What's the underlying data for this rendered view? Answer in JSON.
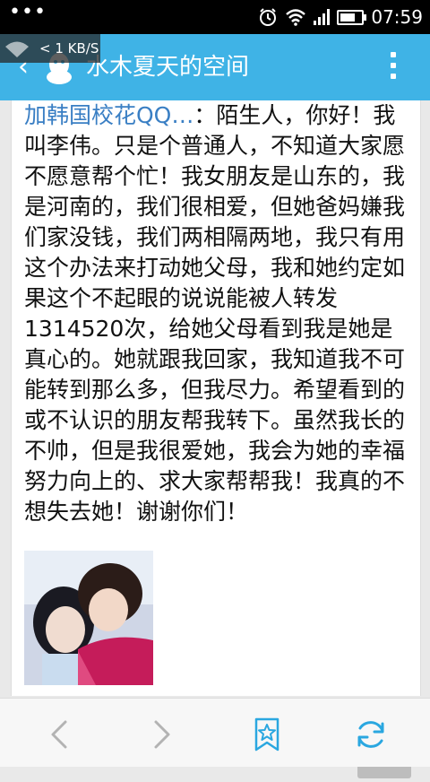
{
  "status_bar": {
    "time": "07:59",
    "icons": [
      "more-dots-icon",
      "alarm-icon",
      "wifi-icon",
      "signal-icon",
      "battery-icon"
    ]
  },
  "overlay": {
    "net_speed": "< 1 KB/S"
  },
  "header": {
    "title": "水木夏天的空间",
    "back_icon": "back-arrow-icon",
    "logo_icon": "qq-penguin-icon",
    "menu_icon": "overflow-menu-icon",
    "color": "#3fb3e6"
  },
  "post": {
    "author": "加韩国校花QQ…",
    "separator": "：",
    "text": "陌生人，你好！我叫李伟。只是个普通人，不知道大家愿不愿意帮个忙！我女朋友是山东的，我是河南的，我们很相爱，但她爸妈嫌我们家没钱，我们两相隔两地，我只有用这个办法来打动她父母，我和她约定如果这个不起眼的说说能被人转发1314520次，给她父母看到我是她是真心的。她就跟我回家，我知道我不可能转到那么多，但我尽力。希望看到的或不认识的朋友帮我转下。虽然我长的不帅，但是我很爱她，我会为她的幸福努力向上的、求大家帮帮我！我真的不想失去她！谢谢你们！",
    "author_color": "#3a7fc4"
  },
  "bottom_bar": {
    "icons": [
      "back-nav-icon",
      "forward-nav-icon",
      "bookmark-star-icon",
      "refresh-icon"
    ],
    "accent": "#2aa7e0"
  }
}
